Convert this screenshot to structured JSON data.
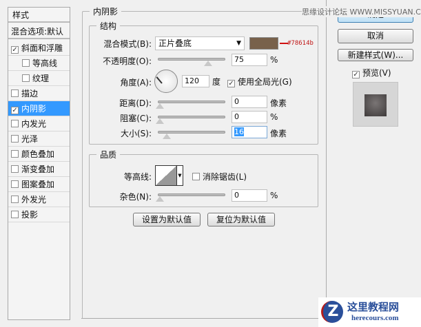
{
  "sidebar": {
    "header": "样式",
    "blend_default": "混合选项:默认",
    "items": [
      {
        "label": "斜面和浮雕",
        "checked": true
      },
      {
        "label": "等高线",
        "checked": false
      },
      {
        "label": "纹理",
        "checked": false
      },
      {
        "label": "描边",
        "checked": false
      },
      {
        "label": "内阴影",
        "checked": true,
        "selected": true
      },
      {
        "label": "内发光",
        "checked": false
      },
      {
        "label": "光泽",
        "checked": false
      },
      {
        "label": "颜色叠加",
        "checked": false
      },
      {
        "label": "渐变叠加",
        "checked": false
      },
      {
        "label": "图案叠加",
        "checked": false
      },
      {
        "label": "外发光",
        "checked": false
      },
      {
        "label": "投影",
        "checked": false
      }
    ]
  },
  "panel": {
    "title": "内阴影",
    "structure": {
      "title": "结构",
      "blend_mode_label": "混合模式(B):",
      "blend_mode": "正片叠底",
      "color": "#78614b",
      "color_annotation": "#78614b",
      "opacity_label": "不透明度(O):",
      "opacity": "75",
      "opacity_unit": "%",
      "angle_label": "角度(A):",
      "angle": "120",
      "angle_unit": "度",
      "global_light_label": "使用全局光(G)",
      "global_light": true,
      "distance_label": "距离(D):",
      "distance": "0",
      "distance_unit": "像素",
      "choke_label": "阻塞(C):",
      "choke": "0",
      "choke_unit": "%",
      "size_label": "大小(S):",
      "size": "16",
      "size_unit": "像素"
    },
    "quality": {
      "title": "品质",
      "contour_label": "等高线:",
      "antialias_label": "消除锯齿(L)",
      "antialias": false,
      "noise_label": "杂色(N):",
      "noise": "0",
      "noise_unit": "%"
    },
    "make_default": "设置为默认值",
    "reset_default": "复位为默认值"
  },
  "actions": {
    "ok": "确定",
    "cancel": "取消",
    "new_style": "新建样式(W)...",
    "preview_label": "预览(V)",
    "preview": true
  },
  "watermarks": {
    "top": "思缘设计论坛 WWW.MISSYUAN.COM",
    "logo_cn": "这里教程网",
    "logo_en": "herecours.com"
  }
}
